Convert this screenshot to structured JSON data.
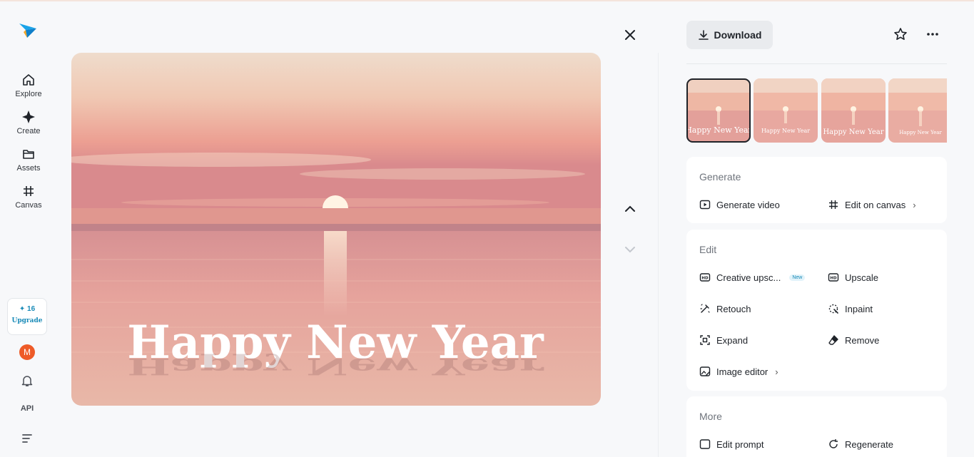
{
  "sidebar": {
    "items": [
      {
        "label": "Explore",
        "icon": "home-icon"
      },
      {
        "label": "Create",
        "icon": "sparkle-icon"
      },
      {
        "label": "Assets",
        "icon": "folder-icon"
      },
      {
        "label": "Canvas",
        "icon": "hash-icon"
      }
    ],
    "upgrade": {
      "credits": "16",
      "label": "Upgrade"
    },
    "avatar_letter": "M",
    "api_label": "API"
  },
  "image": {
    "text": "Happy New Year"
  },
  "thumbnails": [
    {
      "text": "Happy New Year",
      "selected": true
    },
    {
      "text": "Happy New Year",
      "selected": false
    },
    {
      "text": "Happy New Year",
      "selected": false
    },
    {
      "text": "Happy New Year",
      "selected": false
    }
  ],
  "panel": {
    "download_label": "Download",
    "generate": {
      "title": "Generate",
      "generate_video": "Generate video",
      "edit_on_canvas": "Edit on canvas"
    },
    "edit": {
      "title": "Edit",
      "creative_upscale": "Creative upsc...",
      "new_badge": "New",
      "upscale": "Upscale",
      "retouch": "Retouch",
      "inpaint": "Inpaint",
      "expand": "Expand",
      "remove": "Remove",
      "image_editor": "Image editor"
    },
    "more": {
      "title": "More",
      "edit_prompt": "Edit prompt",
      "regenerate": "Regenerate"
    }
  },
  "colors": {
    "accent": "#1a8bb8",
    "avatar": "#ee5b28"
  }
}
